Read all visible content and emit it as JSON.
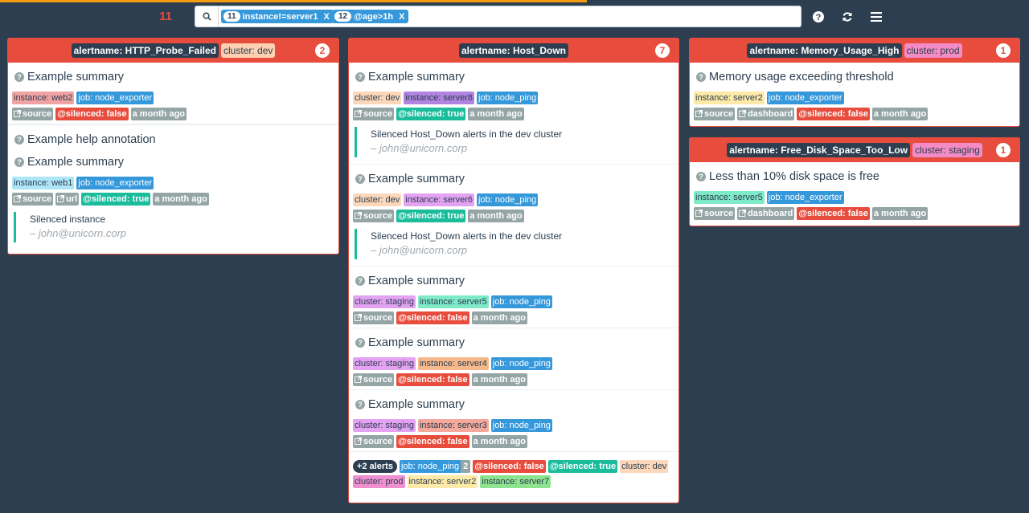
{
  "topbar": {
    "alert_count": "11",
    "filters": [
      {
        "count": "11",
        "text": "instance!=server1",
        "remove": "X"
      },
      {
        "count": "12",
        "text": "@age>1h",
        "remove": "X"
      }
    ],
    "icons": [
      "search-icon",
      "help-icon",
      "refresh-icon",
      "menu-icon"
    ]
  },
  "groups": [
    {
      "alertname": "alertname: HTTP_Probe_Failed",
      "extra": "cluster: dev",
      "count": "2",
      "alerts": [
        {
          "summary": "Example summary",
          "labels": [
            "instance: web2",
            "job: node_exporter"
          ],
          "actions": [
            "source",
            "@silenced: false",
            "a month ago"
          ]
        },
        {
          "help": "Example help annotation",
          "summary": "Example summary",
          "labels": [
            "instance: web1",
            "job: node_exporter"
          ],
          "actions": [
            "source",
            "url",
            "@silenced: true",
            "a month ago"
          ],
          "silence": {
            "comment": "Silenced instance",
            "by": "– john@unicorn.corp"
          }
        }
      ]
    },
    {
      "alertname": "alertname: Host_Down",
      "count": "7",
      "alerts": [
        {
          "summary": "Example summary",
          "labels": [
            "cluster: dev",
            "instance: server8",
            "job: node_ping"
          ],
          "actions": [
            "source",
            "@silenced: true",
            "a month ago"
          ],
          "silence": {
            "comment": "Silenced Host_Down alerts in the dev cluster",
            "by": "– john@unicorn.corp"
          }
        },
        {
          "summary": "Example summary",
          "labels": [
            "cluster: dev",
            "instance: server6",
            "job: node_ping"
          ],
          "actions": [
            "source",
            "@silenced: true",
            "a month ago"
          ],
          "silence": {
            "comment": "Silenced Host_Down alerts in the dev cluster",
            "by": "– john@unicorn.corp"
          }
        },
        {
          "summary": "Example summary",
          "labels": [
            "cluster: staging",
            "instance: server5",
            "job: node_ping"
          ],
          "actions": [
            "source",
            "@silenced: false",
            "a month ago"
          ]
        },
        {
          "summary": "Example summary",
          "labels": [
            "cluster: staging",
            "instance: server4",
            "job: node_ping"
          ],
          "actions": [
            "source",
            "@silenced: false",
            "a month ago"
          ]
        },
        {
          "summary": "Example summary",
          "labels": [
            "cluster: staging",
            "instance: server3",
            "job: node_ping"
          ],
          "actions": [
            "source",
            "@silenced: false",
            "a month ago"
          ]
        }
      ],
      "footer": {
        "more": "+2 alerts",
        "job": "job: node_ping",
        "job_count": "2",
        "tags": [
          "@silenced: false",
          "@silenced: true",
          "cluster: dev",
          "cluster: prod",
          "instance: server2",
          "instance: server7"
        ]
      }
    },
    {
      "alertname": "alertname: Memory_Usage_High",
      "extra": "cluster: prod",
      "count": "1",
      "alerts": [
        {
          "summary": "Memory usage exceeding threshold",
          "labels": [
            "instance: server2",
            "job: node_exporter"
          ],
          "actions": [
            "source",
            "dashboard",
            "@silenced: false",
            "a month ago"
          ]
        }
      ]
    },
    {
      "alertname": "alertname: Free_Disk_Space_Too_Low",
      "extra": "cluster: staging",
      "count": "1",
      "alerts": [
        {
          "summary": "Less than 10% disk space is free",
          "labels": [
            "instance: server5",
            "job: node_exporter"
          ],
          "actions": [
            "source",
            "dashboard",
            "@silenced: false",
            "a month ago"
          ]
        }
      ]
    }
  ]
}
